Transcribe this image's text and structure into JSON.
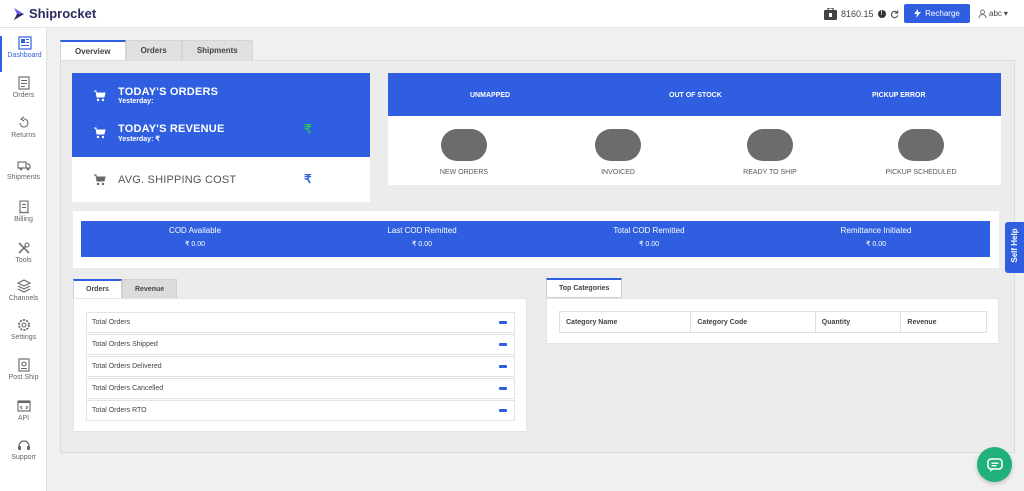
{
  "app": {
    "logo_text": "Shiprocket"
  },
  "header": {
    "wallet_balance": "8160.15",
    "info_glyph": "!",
    "recharge_label": "Recharge",
    "user_name": "abc",
    "user_caret": "▾"
  },
  "sidebar": {
    "items": [
      {
        "label": "Dashboard",
        "icon": "dashboard-icon",
        "active": true
      },
      {
        "label": "Orders",
        "icon": "orders-icon"
      },
      {
        "label": "Returns",
        "icon": "returns-icon"
      },
      {
        "label": "Shipments",
        "icon": "shipments-icon"
      },
      {
        "label": "Billing",
        "icon": "billing-icon"
      },
      {
        "label": "Tools",
        "icon": "tools-icon"
      },
      {
        "label": "Channels",
        "icon": "channels-icon"
      },
      {
        "label": "Settings",
        "icon": "settings-icon"
      },
      {
        "label": "Post Ship",
        "icon": "post-ship-icon"
      },
      {
        "label": "API",
        "icon": "api-icon"
      },
      {
        "label": "Support",
        "icon": "support-icon"
      }
    ]
  },
  "tabs": [
    "Overview",
    "Orders",
    "Shipments"
  ],
  "metrics": {
    "todays_orders": {
      "title": "TODAY'S ORDERS",
      "sub": "Yesterday:"
    },
    "todays_revenue": {
      "title": "TODAY'S REVENUE",
      "sub": "Yesterday: ₹",
      "value": "₹"
    },
    "avg_shipping": {
      "title": "AVG. SHIPPING COST",
      "value": "₹"
    }
  },
  "status_header": [
    "UNMAPPED",
    "OUT OF STOCK",
    "PICKUP ERROR"
  ],
  "status_pills": [
    "NEW ORDERS",
    "INVOICED",
    "READY TO SHIP",
    "PICKUP SCHEDULED"
  ],
  "cod": [
    {
      "label": "COD Available",
      "value": "₹ 0.00"
    },
    {
      "label": "Last COD Remitted",
      "value": "₹ 0.00"
    },
    {
      "label": "Total COD Remitted",
      "value": "₹ 0.00"
    },
    {
      "label": "Remittance Initiated",
      "value": "₹ 0.00"
    }
  ],
  "order_tabs": [
    "Orders",
    "Revenue"
  ],
  "order_rows": [
    "Total Orders",
    "Total Orders Shipped",
    "Total Orders Delivered",
    "Total Orders Cancelled",
    "Total Orders RTO"
  ],
  "categories": {
    "tab": "Top Categories",
    "columns": [
      "Category Name",
      "Category Code",
      "Quantity",
      "Revenue"
    ]
  },
  "self_help": "Self Help",
  "colors": {
    "primary": "#2f5fe0",
    "success": "#27c25a",
    "chat": "#20b07a"
  }
}
